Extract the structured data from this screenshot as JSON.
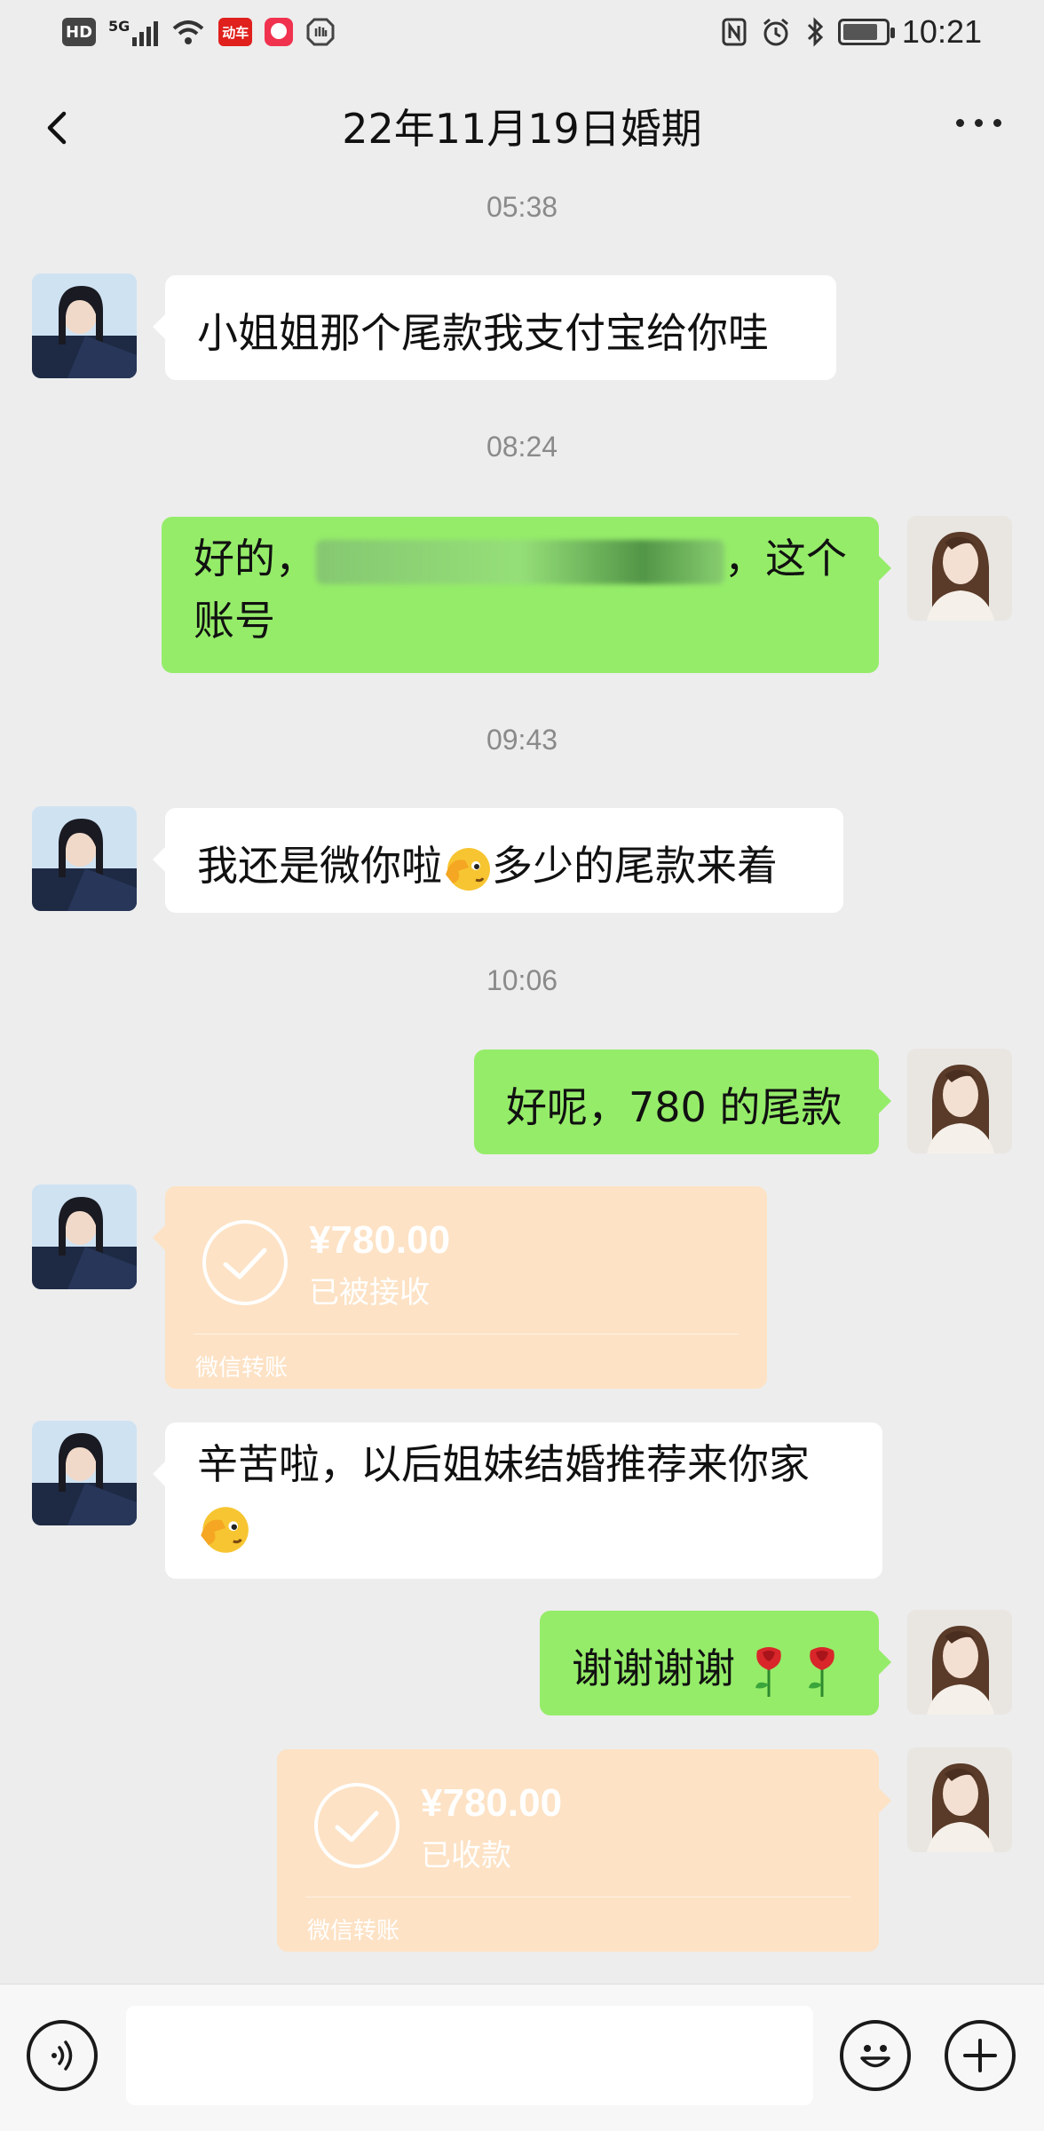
{
  "status_bar": {
    "left_icons": [
      "hd-icon",
      "5g-signal-icon",
      "wifi-icon",
      "app-notification-icon",
      "app-notification-icon-2",
      "shield-icon"
    ],
    "hd_label": "HD",
    "net_label": "5G",
    "app_badge_label": "动车",
    "right_icons": [
      "nfc-icon",
      "alarm-icon",
      "bluetooth-icon",
      "battery-icon"
    ],
    "time": "10:21"
  },
  "nav": {
    "title": "22年11月19日婚期"
  },
  "colors": {
    "background": "#ededed",
    "bubble_out": "#95ec69",
    "bubble_in": "#ffffff",
    "transfer": "#fde2c5"
  },
  "chat": {
    "time_1": "05:38",
    "msg_1": "小姐姐那个尾款我支付宝给你哇",
    "time_2": "08:24",
    "msg_2_prefix": "好的，",
    "msg_2_suffix": "，这个",
    "msg_2_line2": "账号",
    "time_3": "09:43",
    "msg_3_part1": "我还是微你啦",
    "msg_3_part2": "多少的尾款来着",
    "time_4": "10:06",
    "msg_4": "好呢，780 的尾款",
    "transfer_1": {
      "amount": "¥780.00",
      "status": "已被接收",
      "label": "微信转账"
    },
    "msg_5_line1": "辛苦啦，以后姐妹结婚推荐来你家",
    "msg_6": "谢谢谢谢",
    "transfer_2": {
      "amount": "¥780.00",
      "status": "已收款",
      "label": "微信转账"
    }
  },
  "input_bar": {
    "placeholder": ""
  }
}
